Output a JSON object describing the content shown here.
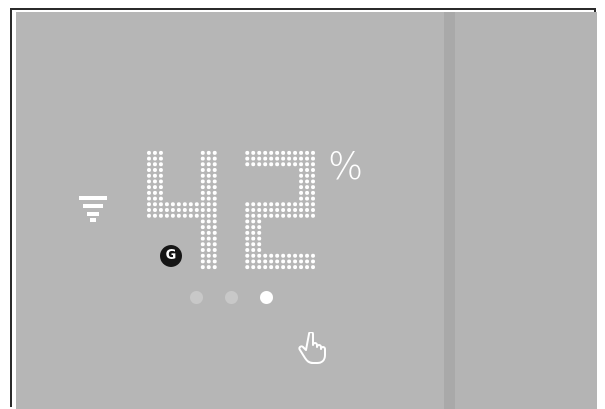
{
  "display": {
    "humidity_value": "42",
    "unit": "%"
  },
  "icons": {
    "network": "network-signal-icon",
    "badge": "google-g-icon",
    "gesture": "touch-hand-icon"
  },
  "badge": {
    "label": "G"
  },
  "pager": {
    "count": 3,
    "active_index": 2
  },
  "colors": {
    "screen_bg": "#b6b6b6",
    "strip": "#a9a9a9",
    "segment_lit": "#ffffff",
    "dot_inactive": "#c8c8c8",
    "badge_bg": "#161616"
  }
}
